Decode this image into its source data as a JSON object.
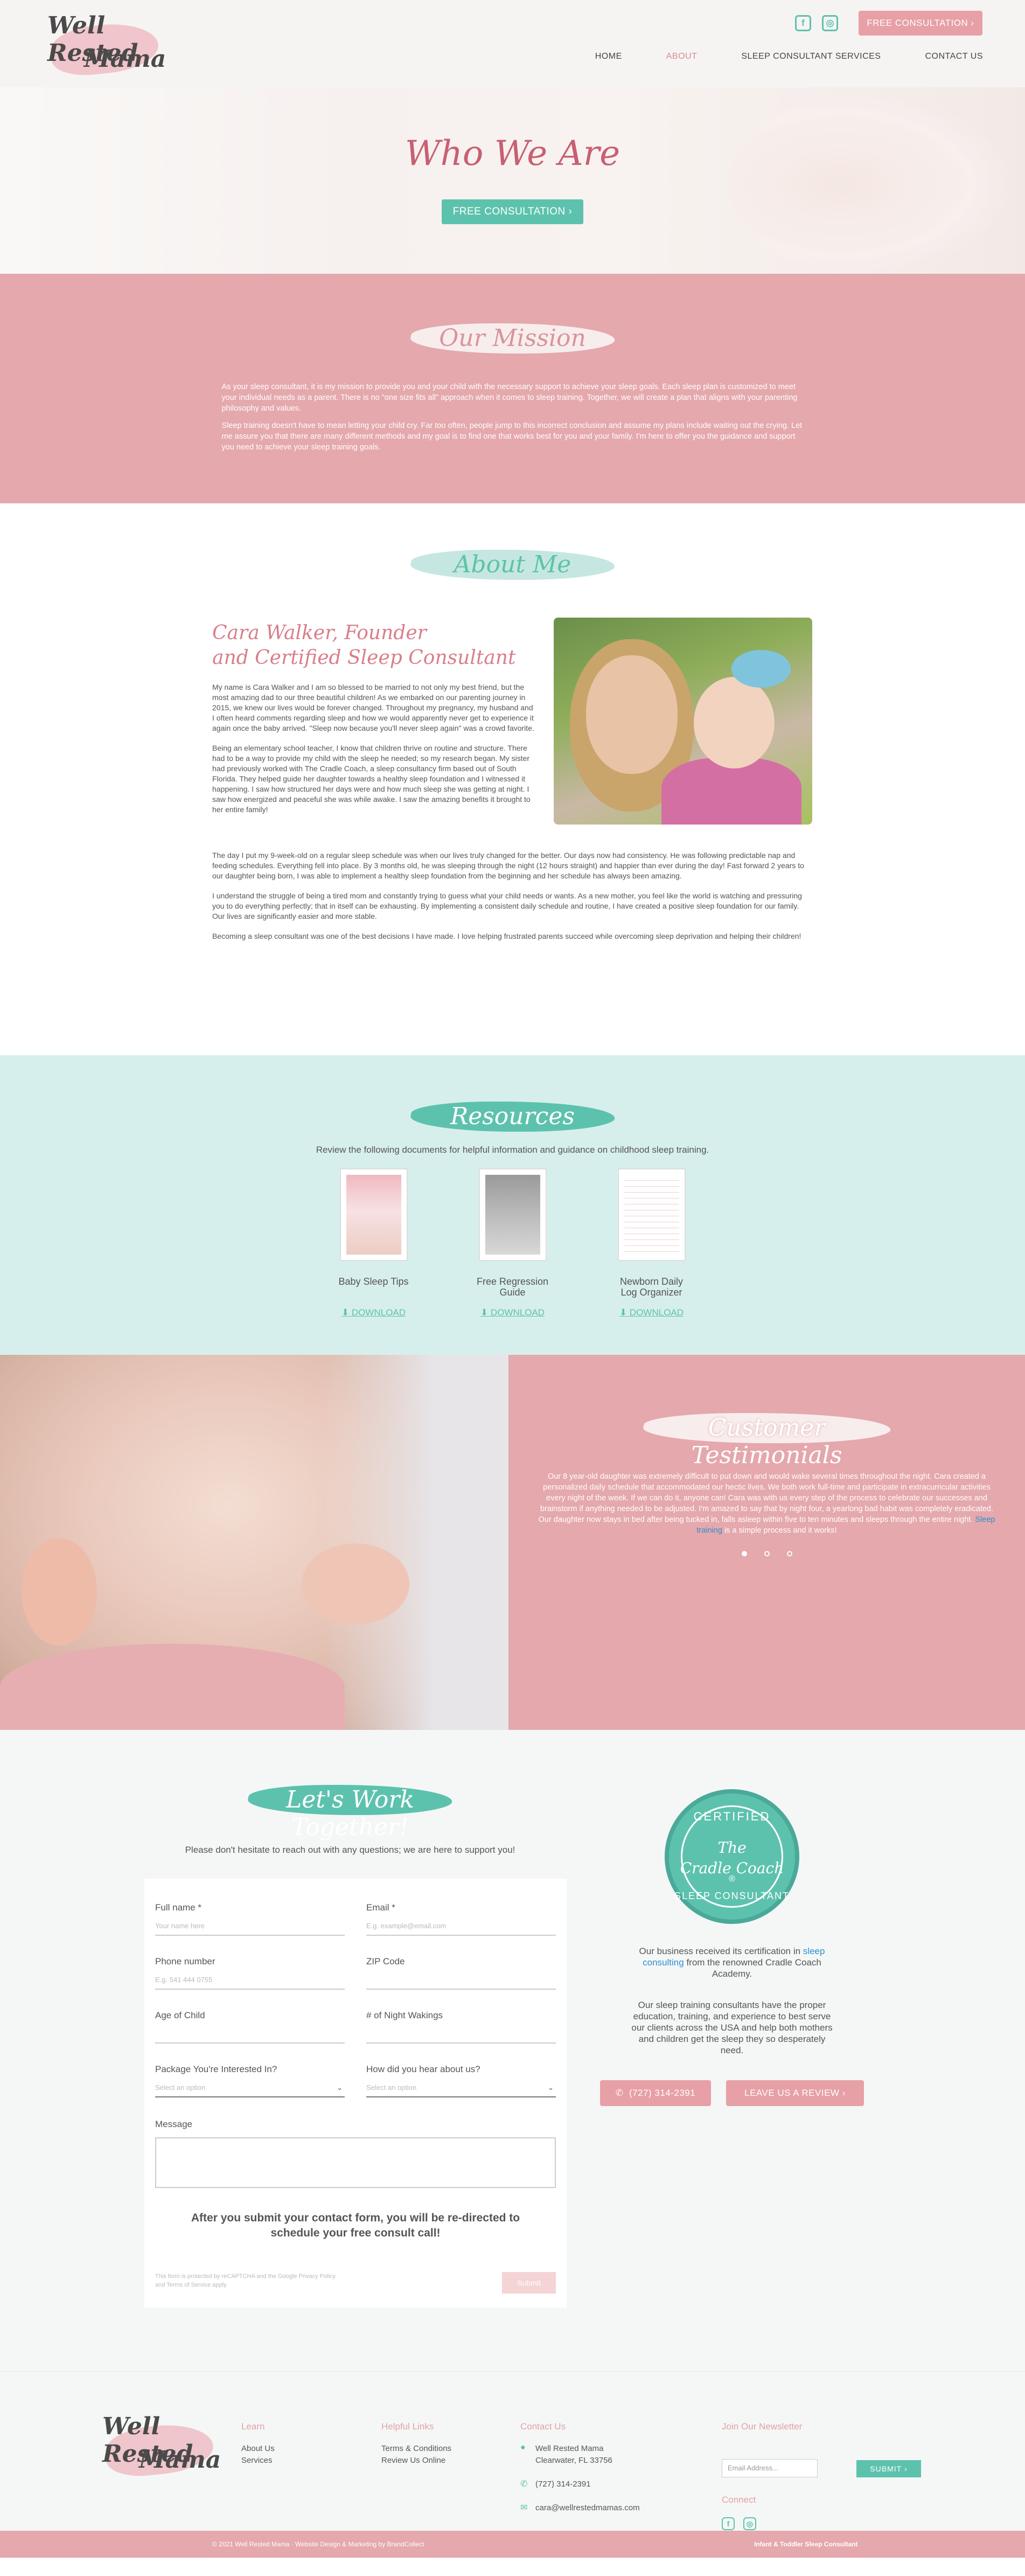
{
  "brand": {
    "line1": "Well Rested",
    "line2": "Mama"
  },
  "header": {
    "cta": "FREE CONSULTATION",
    "social": [
      {
        "icon": "facebook-icon",
        "glyph": "f"
      },
      {
        "icon": "instagram-icon",
        "glyph": "◎"
      }
    ],
    "nav": [
      "HOME",
      "ABOUT",
      "SLEEP CONSULTANT SERVICES",
      "CONTACT US"
    ],
    "active_nav": "ABOUT"
  },
  "hero": {
    "title": "Who We Are",
    "cta": "FREE CONSULTATION"
  },
  "mission": {
    "heading": "Our Mission",
    "p1": "As your sleep consultant, it is my mission to provide you and your child with the necessary support to achieve your sleep goals. Each sleep plan is customized to meet your individual needs as a parent. There is no \"one size fits all\" approach when it comes to sleep training. Together, we will create a plan that aligns with your parenting philosophy and values.",
    "p2": "Sleep training doesn't have to mean letting your child cry. Far too often, people jump to this incorrect conclusion and assume my plans include waiting out the crying. Let me assure you that there are many different methods and my goal is to find one that works best for you and your family. I'm here to offer you the guidance and support you need to achieve your sleep training goals."
  },
  "about": {
    "heading": "About Me",
    "title_line1": "Cara Walker, Founder",
    "title_line2": "and Certified Sleep Consultant",
    "p1": "My name is Cara Walker and I am so blessed to be married to not only my best friend, but the most amazing dad to our three beautiful children! As we embarked on our parenting journey in 2015, we knew our lives would be forever changed. Throughout my pregnancy, my husband and I often heard comments regarding sleep and how we would apparently never get to experience it again once the baby arrived. \"Sleep now because you'll never sleep again\" was a crowd favorite.",
    "p2": "Being an elementary school teacher, I know that children thrive on routine and structure. There had to be a way to provide my child with the sleep he needed; so my research began. My sister had previously worked with The Cradle Coach, a sleep consultancy firm based out of South Florida. They helped guide her daughter towards a healthy sleep foundation and I witnessed it happening. I saw how structured her days were and how much sleep she was getting at night. I saw how energized and peaceful she was while awake. I saw the amazing benefits it brought to her entire family!",
    "p3": "The day I put my 9-week-old on a regular sleep schedule was when our lives truly changed for the better. Our days now had consistency. He was following predictable nap and feeding schedules. Everything fell into place. By 3 months old, he was sleeping through the night (12 hours straight) and happier than ever during the day! Fast forward 2 years to our daughter being born, I was able to implement a healthy sleep foundation from the beginning and her schedule has always been amazing.",
    "p4": "I understand the struggle of being a tired mom and constantly trying to guess what your child needs or wants. As a new mother, you feel like the world is watching and pressuring you to do everything perfectly; that in itself can be exhausting. By implementing a consistent daily schedule and routine, I have created a positive sleep foundation for our family. Our lives are significantly easier and more stable.",
    "p5": "Becoming a sleep consultant was one of the best decisions I have made. I love helping frustrated parents succeed while overcoming sleep deprivation and helping their children!"
  },
  "resources": {
    "heading": "Resources",
    "intro": "Review the following documents for helpful information and guidance on childhood sleep training.",
    "items": [
      {
        "name": "Baby Sleep Tips",
        "download": "DOWNLOAD",
        "color": "#f0b9c0"
      },
      {
        "name": "Free Regression Guide",
        "download": "DOWNLOAD",
        "color": "#9a9a9a"
      },
      {
        "name": "Newborn Daily Log Organizer",
        "download": "DOWNLOAD",
        "color": "#ffffff"
      }
    ]
  },
  "testimonials": {
    "heading": "Customer Testimonials",
    "quote_before": "Our 8 year-old daughter was extremely difficult to put down and would wake several times throughout the night. Cara created a personalized daily schedule that accommodated our hectic lives. We both work full-time and participate in extracurricular activities every night of the week. If we can do it, anyone can! Cara was with us every step of the process to celebrate our successes and brainstorm if anything needed to be adjusted. I'm amazed to say that by night four, a yearlong bad habit was completely eradicated. Our daughter now stays in bed after being tucked in, falls asleep within five to ten minutes and sleeps through the entire night.",
    "quote_link": "Sleep training",
    "quote_after": "is a simple process and it works!"
  },
  "contact": {
    "heading": "Let's Work Together!",
    "intro": "Please don't hesitate to reach out with any questions; we are here to support you!",
    "fields": {
      "full_name": {
        "label": "Full name *",
        "placeholder": "Your name here"
      },
      "email": {
        "label": "Email *",
        "placeholder": "E.g. example@email.com"
      },
      "phone": {
        "label": "Phone number",
        "placeholder": "E.g. 541 444 0755"
      },
      "zip": {
        "label": "ZIP Code",
        "placeholder": ""
      },
      "age": {
        "label": "Age of Child",
        "placeholder": ""
      },
      "wakings": {
        "label": "# of Night Wakings",
        "placeholder": ""
      },
      "package": {
        "label": "Package You're Interested In?",
        "placeholder": "Select an option"
      },
      "hear": {
        "label": "How did you hear about us?",
        "placeholder": "Select an option"
      },
      "message": {
        "label": "Message"
      }
    },
    "note": "After you submit your contact form, you will be re-directed to schedule your free consult call!",
    "fine": "This form is protected by reCAPTCHA and the Google Privacy Policy and Terms of Service apply.",
    "submit": "Submit",
    "cert": {
      "t1": "CERTIFIED",
      "t2": "The",
      "t3": "Cradle Coach",
      "t4": "®",
      "t5": "SLEEP CONSULTANT"
    },
    "cert_text1_before": "Our business received its certification in",
    "cert_text1_link": "sleep consulting",
    "cert_text1_after": "from the renowned Cradle Coach Academy.",
    "cert_text2": "Our sleep training consultants have the proper education, training, and experience to best serve our clients across the USA and help both mothers and children get the sleep they so desperately need.",
    "phone_btn": "(727) 314-2391",
    "review_btn": "LEAVE US A REVIEW"
  },
  "footer": {
    "learn": {
      "title": "Learn",
      "items": [
        "About Us",
        "Services"
      ]
    },
    "helpful": {
      "title": "Helpful Links",
      "items": [
        "Terms & Conditions",
        "Review Us Online"
      ]
    },
    "contact": {
      "title": "Contact Us",
      "name": "Well Rested Mama",
      "city": "Clearwater, FL 33756",
      "phone": "(727) 314-2391",
      "email": "cara@wellrestedmamas.com"
    },
    "newsletter": {
      "title": "Join Our Newsletter",
      "placeholder": "Email Address...",
      "submit": "SUBMIT"
    },
    "connect": "Connect",
    "copyright": "© 2021 Well Rested Mama · Website Design & Marketing by BrandCollect",
    "tagline": "Infant & Toddler Sleep Consultant"
  }
}
